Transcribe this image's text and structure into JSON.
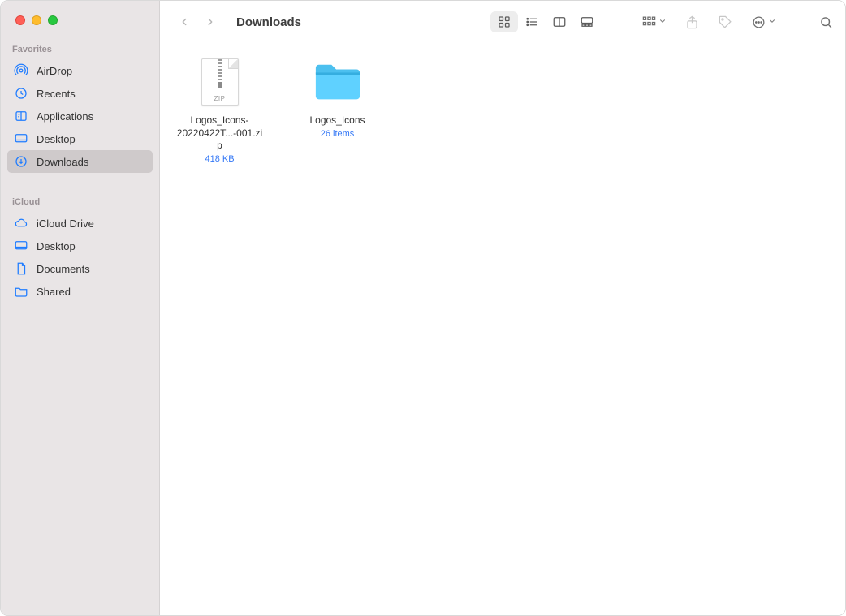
{
  "window": {
    "title": "Downloads"
  },
  "sidebar": {
    "sections": [
      {
        "title": "Favorites",
        "items": [
          {
            "label": "AirDrop",
            "icon": "airdrop-icon"
          },
          {
            "label": "Recents",
            "icon": "clock-icon"
          },
          {
            "label": "Applications",
            "icon": "apps-icon"
          },
          {
            "label": "Desktop",
            "icon": "desktop-icon"
          },
          {
            "label": "Downloads",
            "icon": "download-icon",
            "active": true
          }
        ]
      },
      {
        "title": "iCloud",
        "items": [
          {
            "label": "iCloud Drive",
            "icon": "cloud-icon"
          },
          {
            "label": "Desktop",
            "icon": "desktop-icon"
          },
          {
            "label": "Documents",
            "icon": "document-icon"
          },
          {
            "label": "Shared",
            "icon": "shared-folder-icon"
          }
        ]
      }
    ]
  },
  "files": [
    {
      "name": "Logos_Icons-20220422T...-001.zip",
      "meta": "418 KB",
      "type": "zip",
      "zip_label": "ZIP"
    },
    {
      "name": "Logos_Icons",
      "meta": "26 items",
      "type": "folder"
    }
  ]
}
